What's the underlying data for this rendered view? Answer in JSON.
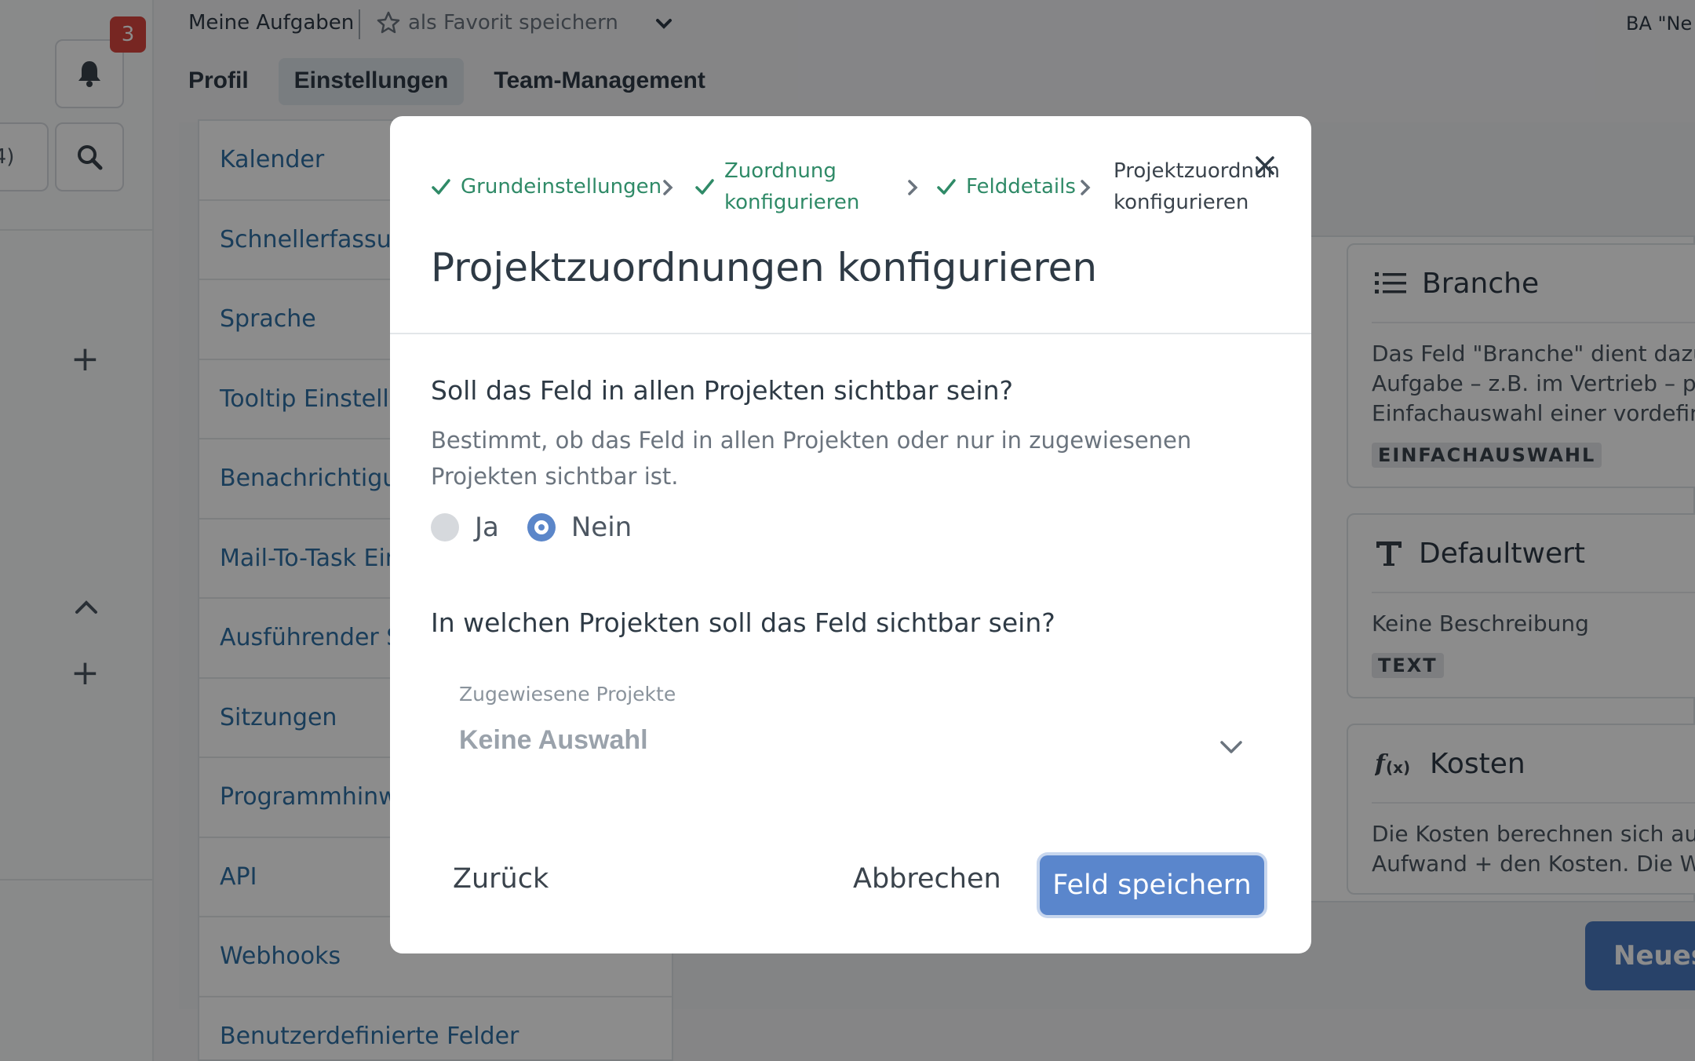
{
  "rail": {
    "notification_count": "3"
  },
  "topbar": {
    "title": "Meine Aufgaben",
    "favorite_label": "als Favorit speichern",
    "right_text": "BA \"Ne"
  },
  "tabs": [
    {
      "label": "Profil"
    },
    {
      "label": "Einstellungen"
    },
    {
      "label": "Team-Management"
    }
  ],
  "settings_nav": [
    {
      "label": "Kalender"
    },
    {
      "label": "Schnellerfassun"
    },
    {
      "label": "Sprache"
    },
    {
      "label": "Tooltip Einstellu"
    },
    {
      "label": "Benachrichtigu"
    },
    {
      "label": "Mail-To-Task Ein"
    },
    {
      "label": "Ausführender S"
    },
    {
      "label": "Sitzungen"
    },
    {
      "label": "Programmhinw"
    },
    {
      "label": "API"
    },
    {
      "label": "Webhooks"
    },
    {
      "label": "Benutzerdefinierte Felder"
    }
  ],
  "field_cards": [
    {
      "title": "Branche",
      "icon": "list-icon",
      "desc": [
        "Das Feld \"Branche\" dient dazu",
        "Aufgabe – z.B. im Vertrieb – pe",
        "Einfachauswahl einer vordefini"
      ],
      "type": "EINFACHAUSWAHL"
    },
    {
      "title": "Defaultwert",
      "icon": "text-icon",
      "desc": [
        "Keine Beschreibung"
      ],
      "type": "TEXT"
    },
    {
      "title": "Kosten",
      "icon": "formula-icon",
      "desc": [
        "Die Kosten berechnen sich aus",
        "Aufwand + den Kosten. Die We"
      ]
    }
  ],
  "new_button_label": "Neues",
  "modal": {
    "steps": [
      {
        "label": "Grundeinstellungen",
        "done": true
      },
      {
        "label_line1": "Zuordnung",
        "label_line2": "konfigurieren",
        "done": true
      },
      {
        "label": "Felddetails",
        "done": true
      },
      {
        "label_line1": "Projektzuordnung",
        "label_line2": "konfigurieren",
        "done": false
      }
    ],
    "title": "Projektzuordnungen konfigurieren",
    "question1": "Soll das Feld in allen Projekten sichtbar sein?",
    "question1_desc": "Bestimmt, ob das Feld in allen Projekten oder nur in zugewiesenen Projekten sichtbar ist.",
    "radio_yes": "Ja",
    "radio_no": "Nein",
    "selected": "Nein",
    "question2": "In welchen Projekten soll das Feld sichtbar sein?",
    "select_label": "Zugewiesene Projekte",
    "select_value": "Keine Auswahl",
    "back_label": "Zurück",
    "cancel_label": "Abbrechen",
    "save_label": "Feld speichern"
  },
  "colors": {
    "accent": "#5a86cc",
    "step_done": "#2f8a67",
    "link": "#2f6fa5",
    "badge": "#d9453f"
  }
}
